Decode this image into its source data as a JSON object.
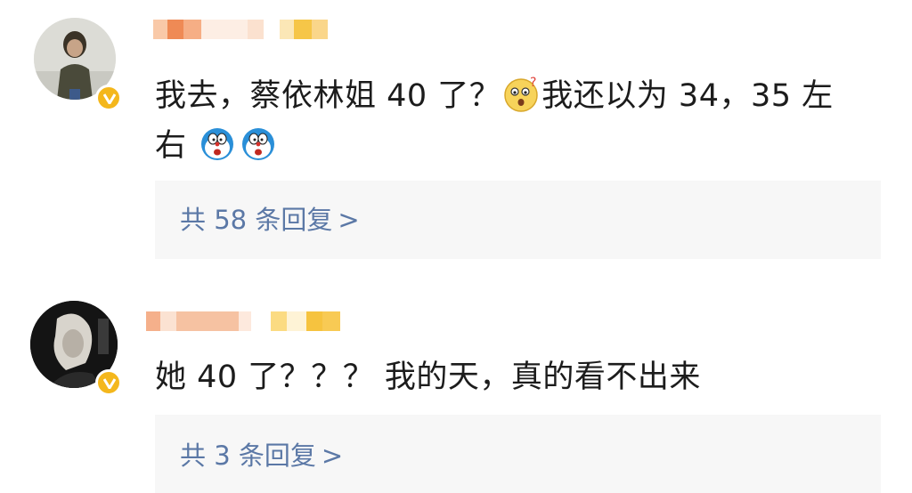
{
  "comments": [
    {
      "text_line1_a": "我去，蔡依林姐 40 了？",
      "text_line1_b": "我还以为 34，35 左",
      "text_line2": "右",
      "emoji_1": "surprised-face-emoji",
      "emoji_2": "doraemon-emoji",
      "reply_count_label": "共 58 条回复",
      "reply_arrow": ">",
      "badge_color": "#f4b71c"
    },
    {
      "text_line1": "她 40 了？？？ 我的天，真的看不出来",
      "reply_count_label": "共 3 条回复",
      "reply_arrow": ">",
      "badge_color": "#f4b71c"
    }
  ],
  "colors": {
    "link": "#5b78a6",
    "reply_bg": "#f7f7f7",
    "text": "#1c1c1c"
  }
}
